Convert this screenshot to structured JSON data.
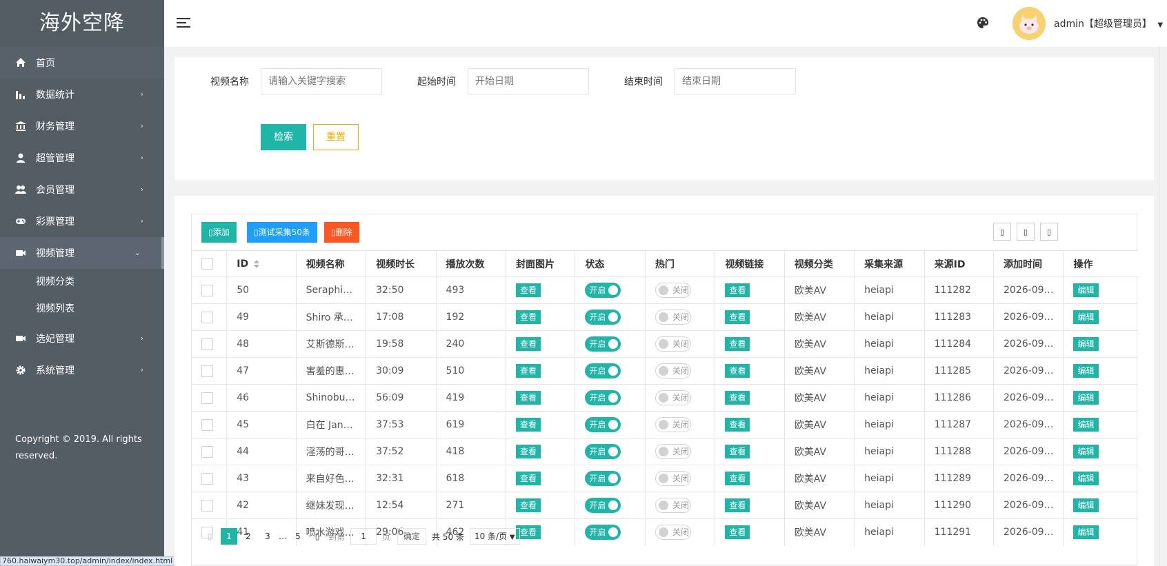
{
  "sidebar": {
    "logo": "海外空降",
    "items": [
      {
        "label": "首页",
        "icon": "home-icon",
        "arrow": ""
      },
      {
        "label": "数据统计",
        "icon": "bar-chart-icon",
        "arrow": "›"
      },
      {
        "label": "财务管理",
        "icon": "bank-icon",
        "arrow": "›"
      },
      {
        "label": "超管管理",
        "icon": "user-icon",
        "arrow": "›"
      },
      {
        "label": "会员管理",
        "icon": "users-icon",
        "arrow": "›"
      },
      {
        "label": "彩票管理",
        "icon": "gamepad-icon",
        "arrow": "›"
      },
      {
        "label": "视频管理",
        "icon": "video-icon",
        "arrow": "⌄"
      },
      {
        "label": "选妃管理",
        "icon": "video-icon",
        "arrow": "›"
      },
      {
        "label": "系统管理",
        "icon": "gear-icon",
        "arrow": "›"
      }
    ],
    "sub_items": [
      "视频分类",
      "视频列表"
    ],
    "copyright": "Copyright © 2019. All rights reserved."
  },
  "status_url": "760.haiwaiym30.top/admin/index/index.html",
  "header": {
    "user_label": "admin【超级管理员】",
    "accent": "#1fb6a7"
  },
  "filter": {
    "name_label": "视频名称",
    "name_placeholder": "请输入关键字搜索",
    "start_label": "起始时间",
    "start_placeholder": "开始日期",
    "end_label": "结束时间",
    "end_placeholder": "结束日期",
    "search_button": "检索",
    "reset_button": "重置"
  },
  "toolbar": {
    "add": "添加",
    "collect": "测试采集50条",
    "delete": "删除"
  },
  "table": {
    "headers": [
      "",
      "ID",
      "视频名称",
      "视频时长",
      "播放次数",
      "封面图片",
      "状态",
      "热门",
      "视频链接",
      "视频分类",
      "采集来源",
      "来源ID",
      "添加时间",
      "操作"
    ],
    "view_label": "查看",
    "on_label": "开启",
    "off_label": "关闭",
    "edit_label": "编辑",
    "rows": [
      {
        "id": "50",
        "name": "Seraphi…",
        "duration": "32:50",
        "plays": "493",
        "category": "欧美AV",
        "source": "heiapi",
        "source_id": "111282",
        "added": "2026-09…"
      },
      {
        "id": "49",
        "name": "Shiro 承…",
        "duration": "17:08",
        "plays": "192",
        "category": "欧美AV",
        "source": "heiapi",
        "source_id": "111283",
        "added": "2026-09…"
      },
      {
        "id": "48",
        "name": "艾斯德斯…",
        "duration": "19:58",
        "plays": "240",
        "category": "欧美AV",
        "source": "heiapi",
        "source_id": "111284",
        "added": "2026-09…"
      },
      {
        "id": "47",
        "name": "害羞的惠…",
        "duration": "30:09",
        "plays": "510",
        "category": "欧美AV",
        "source": "heiapi",
        "source_id": "111285",
        "added": "2026-09…"
      },
      {
        "id": "46",
        "name": "Shinobu…",
        "duration": "56:09",
        "plays": "419",
        "category": "欧美AV",
        "source": "heiapi",
        "source_id": "111286",
        "added": "2026-09…"
      },
      {
        "id": "45",
        "name": "白在 Jan…",
        "duration": "37:53",
        "plays": "619",
        "category": "欧美AV",
        "source": "heiapi",
        "source_id": "111287",
        "added": "2026-09…"
      },
      {
        "id": "44",
        "name": "淫荡的哥…",
        "duration": "37:52",
        "plays": "418",
        "category": "欧美AV",
        "source": "heiapi",
        "source_id": "111288",
        "added": "2026-09…"
      },
      {
        "id": "43",
        "name": "来自好色…",
        "duration": "32:31",
        "plays": "618",
        "category": "欧美AV",
        "source": "heiapi",
        "source_id": "111289",
        "added": "2026-09…"
      },
      {
        "id": "42",
        "name": "继妹发现…",
        "duration": "12:54",
        "plays": "271",
        "category": "欧美AV",
        "source": "heiapi",
        "source_id": "111290",
        "added": "2026-09…"
      },
      {
        "id": "41",
        "name": "喷水游戏…",
        "duration": "29:06",
        "plays": "462",
        "category": "欧美AV",
        "source": "heiapi",
        "source_id": "111291",
        "added": "2026-09…"
      }
    ]
  },
  "pagination": {
    "pages": [
      "1",
      "2",
      "3",
      "…",
      "5"
    ],
    "current": "1",
    "goto_label": "到第",
    "goto_value": "1",
    "page_unit": "页",
    "confirm": "确定",
    "total": "共 50 条",
    "per_page": "10 条/页"
  }
}
